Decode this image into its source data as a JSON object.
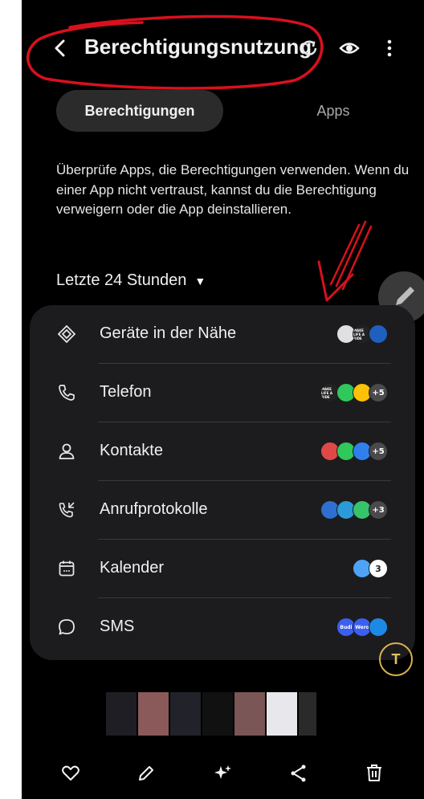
{
  "header": {
    "title": "Berechtigungsnutzung",
    "back_icon": "chevron-left-icon",
    "actions": [
      "refresh-icon",
      "eye-icon",
      "more-vert-icon"
    ],
    "annotation_color": "#d9101e"
  },
  "tabs": [
    {
      "label": "Berechtigungen",
      "active": true
    },
    {
      "label": "Apps",
      "active": false
    }
  ],
  "description": "Überprüfe Apps, die Berechtigungen verwenden. Wenn du einer App nicht vertraust, kannst du die Berechtigung verweigern oder die App deinstallieren.",
  "period": {
    "label": "Letzte 24 Stunden"
  },
  "permissions": [
    {
      "label": "Geräte in der Nähe",
      "icon": "nearby-devices-icon",
      "apps": [
        {
          "color": "#e0e0e0"
        },
        {
          "color": "#222222",
          "text": "MAKE LIFE A RIDE"
        },
        {
          "color": "#1f5fbf"
        }
      ]
    },
    {
      "label": "Telefon",
      "icon": "phone-icon",
      "apps": [
        {
          "color": "#222222",
          "text": "MAKE LIFE A RIDE"
        },
        {
          "color": "#30c85a"
        },
        {
          "color": "#ffc107"
        }
      ],
      "more": "+5"
    },
    {
      "label": "Kontakte",
      "icon": "person-icon",
      "apps": [
        {
          "color": "#e04848"
        },
        {
          "color": "#30c85a"
        },
        {
          "color": "#2f80ed"
        }
      ],
      "more": "+5"
    },
    {
      "label": "Anrufprotokolle",
      "icon": "call-log-icon",
      "apps": [
        {
          "color": "#2e6fd0"
        },
        {
          "color": "#2c9ad6"
        },
        {
          "color": "#36c46b"
        }
      ],
      "more": "+3"
    },
    {
      "label": "Kalender",
      "icon": "calendar-icon",
      "apps": [
        {
          "color": "#4fa3f7"
        },
        {
          "color": "#ffffff",
          "text": "3"
        }
      ]
    },
    {
      "label": "SMS",
      "icon": "message-icon",
      "apps": [
        {
          "color": "#3b5ff0",
          "text": "Budi"
        },
        {
          "color": "#3b5ff0",
          "text": "Wero"
        },
        {
          "color": "#1e88e5"
        }
      ]
    }
  ],
  "fab": {
    "icon": "pencil-icon"
  },
  "scan": {
    "icon": "text-scan-icon",
    "label": "T"
  },
  "bottom_bar": [
    "heart-icon",
    "edit-icon",
    "sparkle-icon",
    "share-icon",
    "trash-icon"
  ]
}
